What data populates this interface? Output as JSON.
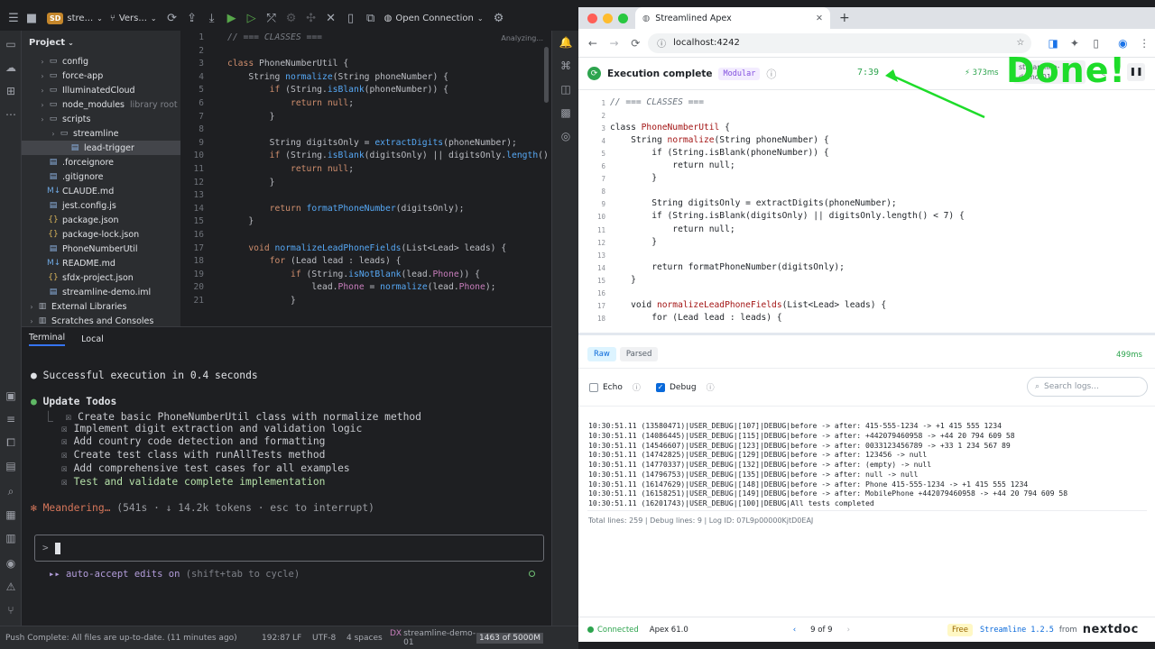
{
  "ide": {
    "project_badge": "SD",
    "project_name": "stre...",
    "vcs_label": "Vers...",
    "open_connection": "Open Connection",
    "project_panel_title": "Project",
    "tree": [
      {
        "label": "config",
        "type": "folder",
        "indent": 1,
        "muted": ""
      },
      {
        "label": "force-app",
        "type": "folder",
        "indent": 1,
        "muted": ""
      },
      {
        "label": "IlluminatedCloud",
        "type": "folder",
        "indent": 1,
        "muted": ""
      },
      {
        "label": "node_modules",
        "type": "folder",
        "indent": 1,
        "muted": "library root"
      },
      {
        "label": "scripts",
        "type": "folder",
        "indent": 1,
        "muted": ""
      },
      {
        "label": "streamline",
        "type": "folder",
        "indent": 2,
        "muted": ""
      },
      {
        "label": "lead-trigger",
        "type": "file",
        "indent": 3,
        "muted": ""
      },
      {
        "label": ".forceignore",
        "type": "file",
        "indent": 1,
        "muted": ""
      },
      {
        "label": ".gitignore",
        "type": "file",
        "indent": 1,
        "muted": ""
      },
      {
        "label": "CLAUDE.md",
        "type": "md",
        "indent": 1,
        "muted": ""
      },
      {
        "label": "jest.config.js",
        "type": "file",
        "indent": 1,
        "muted": ""
      },
      {
        "label": "package.json",
        "type": "json",
        "indent": 1,
        "muted": ""
      },
      {
        "label": "package-lock.json",
        "type": "json",
        "indent": 1,
        "muted": ""
      },
      {
        "label": "PhoneNumberUtil",
        "type": "file",
        "indent": 1,
        "muted": ""
      },
      {
        "label": "README.md",
        "type": "md",
        "indent": 1,
        "muted": ""
      },
      {
        "label": "sfdx-project.json",
        "type": "json",
        "indent": 1,
        "muted": ""
      },
      {
        "label": "streamline-demo.iml",
        "type": "file",
        "indent": 1,
        "muted": ""
      },
      {
        "label": "External Libraries",
        "type": "lib",
        "indent": 0,
        "muted": ""
      },
      {
        "label": "Scratches and Consoles",
        "type": "lib",
        "indent": 0,
        "muted": ""
      }
    ],
    "analyzing": "Analyzing...",
    "editor_lines": [
      {
        "n": "1",
        "t": "// === CLASSES ==="
      },
      {
        "n": "2",
        "t": ""
      },
      {
        "n": "3",
        "t": "class PhoneNumberUtil {"
      },
      {
        "n": "4",
        "t": "    String normalize(String phoneNumber) {"
      },
      {
        "n": "5",
        "t": "        if (String.isBlank(phoneNumber)) {"
      },
      {
        "n": "6",
        "t": "            return null;"
      },
      {
        "n": "7",
        "t": "        }"
      },
      {
        "n": "8",
        "t": ""
      },
      {
        "n": "9",
        "t": "        String digitsOnly = extractDigits(phoneNumber);"
      },
      {
        "n": "10",
        "t": "        if (String.isBlank(digitsOnly) || digitsOnly.length() <"
      },
      {
        "n": "11",
        "t": "            return null;"
      },
      {
        "n": "12",
        "t": "        }"
      },
      {
        "n": "13",
        "t": ""
      },
      {
        "n": "14",
        "t": "        return formatPhoneNumber(digitsOnly);"
      },
      {
        "n": "15",
        "t": "    }"
      },
      {
        "n": "16",
        "t": ""
      },
      {
        "n": "17",
        "t": "    void normalizeLeadPhoneFields(List<Lead> leads) {"
      },
      {
        "n": "18",
        "t": "        for (Lead lead : leads) {"
      },
      {
        "n": "19",
        "t": "            if (String.isNotBlank(lead.Phone)) {"
      },
      {
        "n": "20",
        "t": "                lead.Phone = normalize(lead.Phone);"
      },
      {
        "n": "21",
        "t": "            }"
      }
    ],
    "terminal": {
      "tab_terminal": "Terminal",
      "tab_local": "Local",
      "success": "Successful execution in 0.4 seconds",
      "todos_title": "Update Todos",
      "todos": [
        "Create basic PhoneNumberUtil class with normalize method",
        "Implement digit extraction and validation logic",
        "Add country code detection and formatting",
        "Create test class with runAllTests method",
        "Add comprehensive test cases for all examples",
        "Test and validate complete implementation"
      ],
      "status": "Meandering…",
      "status_detail": "(541s · ↓ 14.2k tokens · esc to interrupt)",
      "prompt": ">",
      "autoaccept": "▸▸ auto-accept edits on",
      "autoaccept_hint": "(shift+tab to cycle)"
    },
    "statusbar": {
      "message": "Push Complete: All files are up-to-date. (11 minutes ago)",
      "position": "192:87",
      "line_ending": "LF",
      "encoding": "UTF-8",
      "indent": "4 spaces",
      "connection": "streamline-demo-01",
      "memory": "1463 of 5000M"
    }
  },
  "browser": {
    "tab_title": "Streamlined Apex",
    "url": "localhost:4242",
    "exec_status": "Execution complete",
    "mode_badge": "Modular",
    "timer": "7:39",
    "duration": "⚡ 373ms",
    "org": "streamline-\ndemo-01",
    "annotation": "Done!",
    "code_lines": [
      {
        "n": "1",
        "t": "// === CLASSES ==="
      },
      {
        "n": "2",
        "t": ""
      },
      {
        "n": "3",
        "t": "class PhoneNumberUtil {"
      },
      {
        "n": "4",
        "t": "    String normalize(String phoneNumber) {"
      },
      {
        "n": "5",
        "t": "        if (String.isBlank(phoneNumber)) {"
      },
      {
        "n": "6",
        "t": "            return null;"
      },
      {
        "n": "7",
        "t": "        }"
      },
      {
        "n": "8",
        "t": ""
      },
      {
        "n": "9",
        "t": "        String digitsOnly = extractDigits(phoneNumber);"
      },
      {
        "n": "10",
        "t": "        if (String.isBlank(digitsOnly) || digitsOnly.length() < 7) {"
      },
      {
        "n": "11",
        "t": "            return null;"
      },
      {
        "n": "12",
        "t": "        }"
      },
      {
        "n": "13",
        "t": ""
      },
      {
        "n": "14",
        "t": "        return formatPhoneNumber(digitsOnly);"
      },
      {
        "n": "15",
        "t": "    }"
      },
      {
        "n": "16",
        "t": ""
      },
      {
        "n": "17",
        "t": "    void normalizeLeadPhoneFields(List<Lead> leads) {"
      },
      {
        "n": "18",
        "t": "        for (Lead lead : leads) {"
      }
    ],
    "tab_raw": "Raw",
    "tab_parsed": "Parsed",
    "log_time": "499ms",
    "echo_label": "Echo",
    "debug_label": "Debug",
    "search_placeholder": "Search logs...",
    "logs": [
      "10:30:51.11 (13580471)|USER_DEBUG|[107]|DEBUG|before -> after: 415-555-1234 -> +1 415 555 1234",
      "10:30:51.11 (14086445)|USER_DEBUG|[115]|DEBUG|before -> after: +442079460958 -> +44 20 794 609 58",
      "10:30:51.11 (14546607)|USER_DEBUG|[123]|DEBUG|before -> after: 0033123456789 -> +33 1 234 567 89",
      "10:30:51.11 (14742825)|USER_DEBUG|[129]|DEBUG|before -> after: 123456 -> null",
      "10:30:51.11 (14770337)|USER_DEBUG|[132]|DEBUG|before -> after: (empty) -> null",
      "10:30:51.11 (14796753)|USER_DEBUG|[135]|DEBUG|before -> after: null -> null",
      "10:30:51.11 (16147629)|USER_DEBUG|[148]|DEBUG|before -> after: Phone 415-555-1234 -> +1 415 555 1234",
      "10:30:51.11 (16158251)|USER_DEBUG|[149]|DEBUG|before -> after: MobilePhone +442079460958 -> +44 20 794 609 58",
      "10:30:51.11 (16201743)|USER_DEBUG|[100]|DEBUG|All tests completed"
    ],
    "log_summary": "Total lines: 259 | Debug lines: 9 | Log ID: 07L9p00000KjtD0EAJ",
    "footer": {
      "connected": "Connected",
      "api": "Apex 61.0",
      "pager": "9 of 9",
      "plan": "Free",
      "product": "Streamline 1.2.5",
      "from": "from",
      "brand": "nextdoc"
    }
  },
  "colors": {
    "accent": "#3574f0",
    "success": "#1edc2a",
    "badge": "#8250df"
  }
}
